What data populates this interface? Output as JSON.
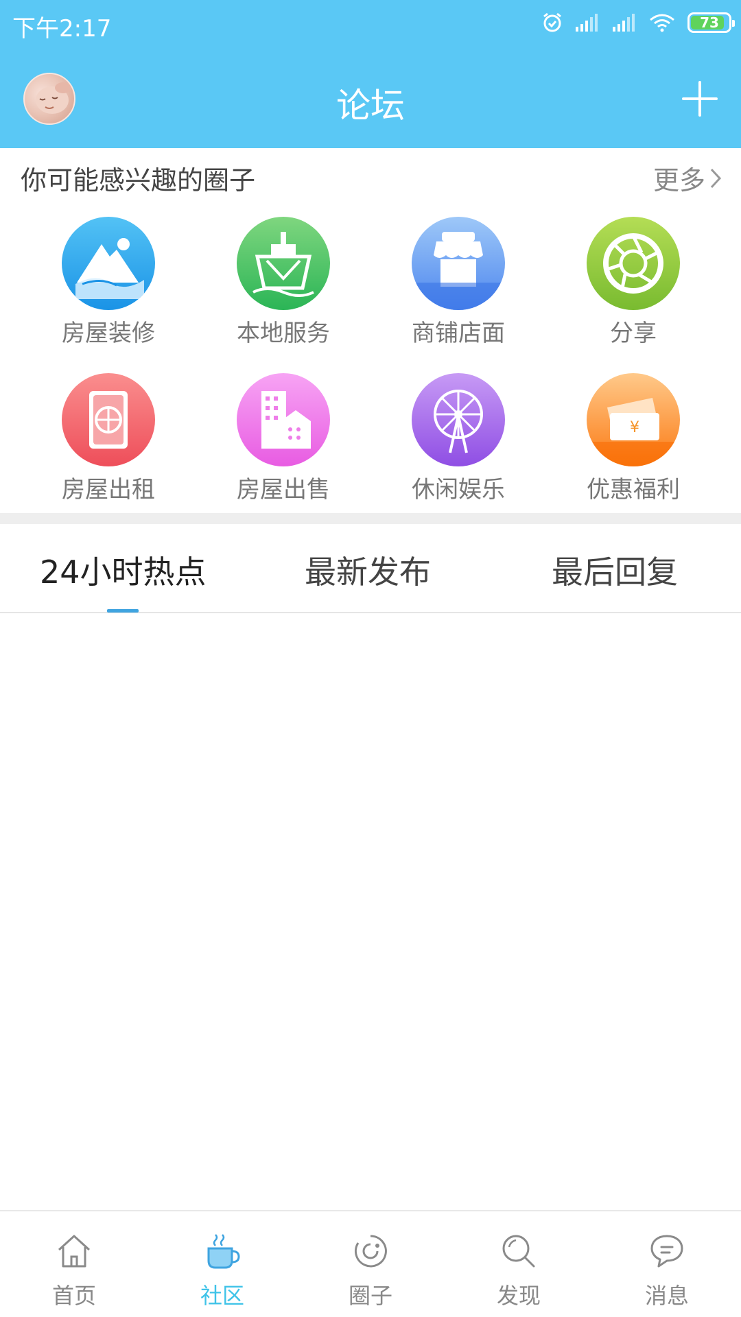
{
  "status_bar": {
    "time": "下午2:17",
    "battery_level": "73",
    "icons": [
      "alarm-icon",
      "signal-icon",
      "signal-icon",
      "wifi-icon",
      "battery-icon"
    ]
  },
  "header": {
    "title": "论坛",
    "left_icon": "avatar",
    "right_icon": "plus-icon"
  },
  "interest": {
    "title": "你可能感兴趣的圈子",
    "more_label": "更多",
    "categories": [
      {
        "label": "房屋装修",
        "icon": "mountain-icon",
        "color": "#2aa5ec"
      },
      {
        "label": "本地服务",
        "icon": "ship-icon",
        "color": "#45c565"
      },
      {
        "label": "商铺店面",
        "icon": "shop-icon",
        "color": "#5a93f0"
      },
      {
        "label": "分享",
        "icon": "aperture-icon",
        "color": "#8cc63f"
      },
      {
        "label": "房屋出租",
        "icon": "globe-icon",
        "color": "#f2676e"
      },
      {
        "label": "房屋出售",
        "icon": "building-icon",
        "color": "#ef6ee8"
      },
      {
        "label": "休闲娱乐",
        "icon": "ferris-wheel-icon",
        "color": "#a367ea"
      },
      {
        "label": "优惠福利",
        "icon": "ticket-icon",
        "color": "#fb8a2d"
      }
    ]
  },
  "tabs": [
    {
      "label": "24小时热点",
      "active": true
    },
    {
      "label": "最新发布",
      "active": false
    },
    {
      "label": "最后回复",
      "active": false
    }
  ],
  "bottom_nav": [
    {
      "label": "首页",
      "icon": "home-icon",
      "active": false
    },
    {
      "label": "社区",
      "icon": "coffee-cup-icon",
      "active": true
    },
    {
      "label": "圈子",
      "icon": "circle-refresh-icon",
      "active": false
    },
    {
      "label": "发现",
      "icon": "search-icon",
      "active": false
    },
    {
      "label": "消息",
      "icon": "chat-bubble-icon",
      "active": false
    }
  ],
  "colors": {
    "primary": "#5ac8f5",
    "tab_indicator": "#3fa4e0",
    "nav_active": "#3fc3e8"
  }
}
